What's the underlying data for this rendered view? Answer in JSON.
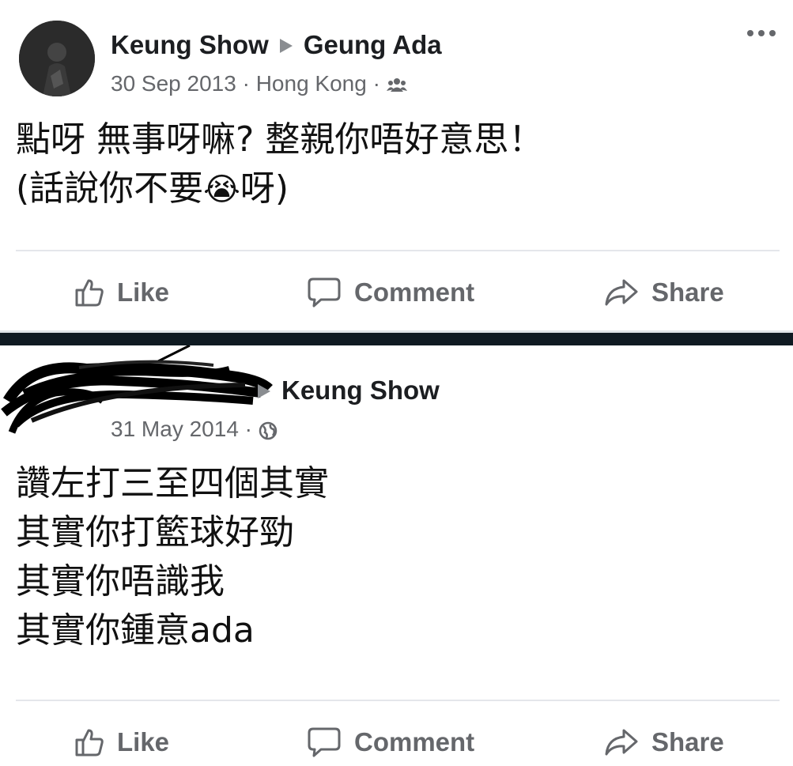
{
  "post1": {
    "author": "Keung Show",
    "recipient": "Geung Ada",
    "date": "30 Sep 2013",
    "location": "Hong Kong",
    "separator": "·",
    "privacy_icon": "friends-icon",
    "text_line1": "點呀 無事呀嘛? 整親你唔好意思！",
    "text_line2_before": "(話說你不要",
    "emoji": "😭",
    "text_line2_after": "呀)"
  },
  "post2": {
    "author_redacted": true,
    "recipient": "Keung Show",
    "date": "31 May 2014",
    "separator": "·",
    "privacy_icon": "globe-icon",
    "lines": [
      "讚左打三至四個其實",
      "其實你打籃球好勁",
      "其實你唔識我",
      "其實你鍾意ada"
    ]
  },
  "actions": {
    "like": "Like",
    "comment": "Comment",
    "share": "Share"
  },
  "colors": {
    "text": "#050505",
    "secondary": "#65676b",
    "divider_band": "#0f1a22"
  }
}
